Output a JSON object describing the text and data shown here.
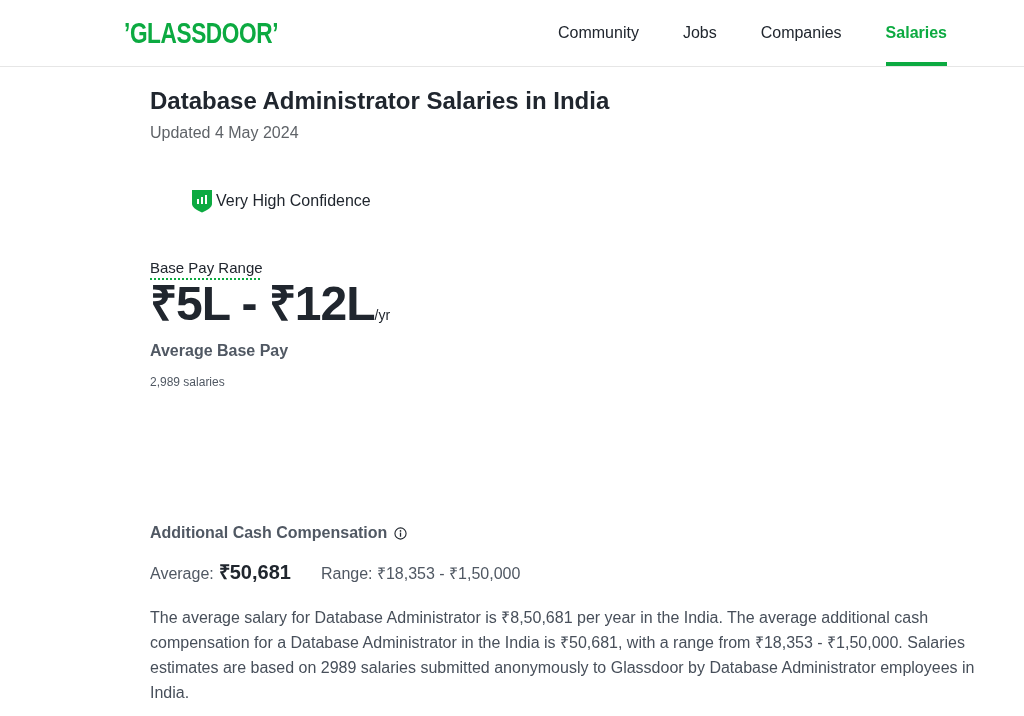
{
  "header": {
    "logo": "’GLASSDOOR’",
    "nav": [
      {
        "label": "Community",
        "selected": false
      },
      {
        "label": "Jobs",
        "selected": false
      },
      {
        "label": "Companies",
        "selected": false
      },
      {
        "label": "Salaries",
        "selected": true
      }
    ]
  },
  "title": "Database Administrator Salaries in India",
  "updated": "Updated 4 May 2024",
  "confidence": {
    "label": "Very High Confidence"
  },
  "base_pay": {
    "label": "Base Pay Range",
    "range": "₹5L - ₹12L",
    "unit": "/yr",
    "caption": "Average Base Pay",
    "count": "2,989 salaries"
  },
  "additional": {
    "title": "Additional Cash Compensation",
    "average_label": "Average:",
    "average_value": "₹50,681",
    "range": "Range: ₹18,353 - ₹1,50,000"
  },
  "summary": "The average salary for Database Administrator is ₹8,50,681 per year in the India. The average additional cash compensation for a Database Administrator in the India is ₹50,681, with a range from ₹18,353 - ₹1,50,000. Salaries estimates are based on 2989 salaries submitted anonymously to Glassdoor by Database Administrator employees in India."
}
